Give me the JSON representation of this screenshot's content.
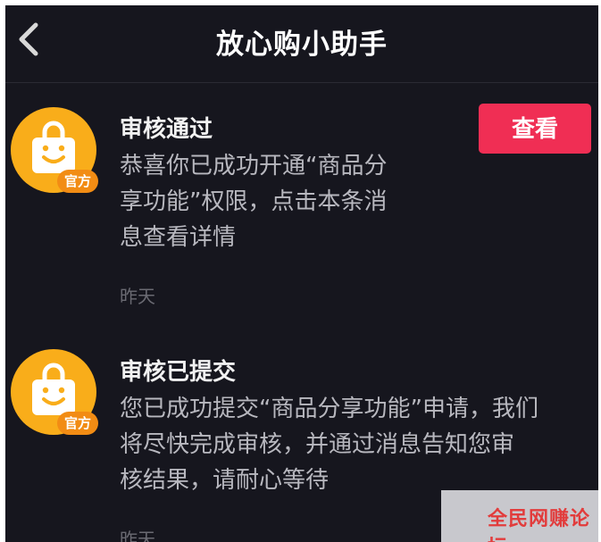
{
  "header": {
    "title": "放心购小助手"
  },
  "messages": [
    {
      "badge": "官方",
      "title": "审核通过",
      "body_lines": [
        "恭喜你已成功开通“商品分",
        "享功能”权限，点击本条消",
        "息查看详情"
      ],
      "time": "昨天",
      "action_label": "查看"
    },
    {
      "badge": "官方",
      "title": "审核已提交",
      "body_lines": [
        "您已成功提交“商品分享功能”申请，我们",
        "将尽快完成审核，并通过消息告知您审",
        "核结果，请耐心等待"
      ],
      "time": "昨天"
    }
  ],
  "watermark": "全民网赚论坛",
  "colors": {
    "background": "#16161e",
    "accent": "#f02e54",
    "avatar": "#f9ad1a",
    "badge": "#f28c14"
  }
}
